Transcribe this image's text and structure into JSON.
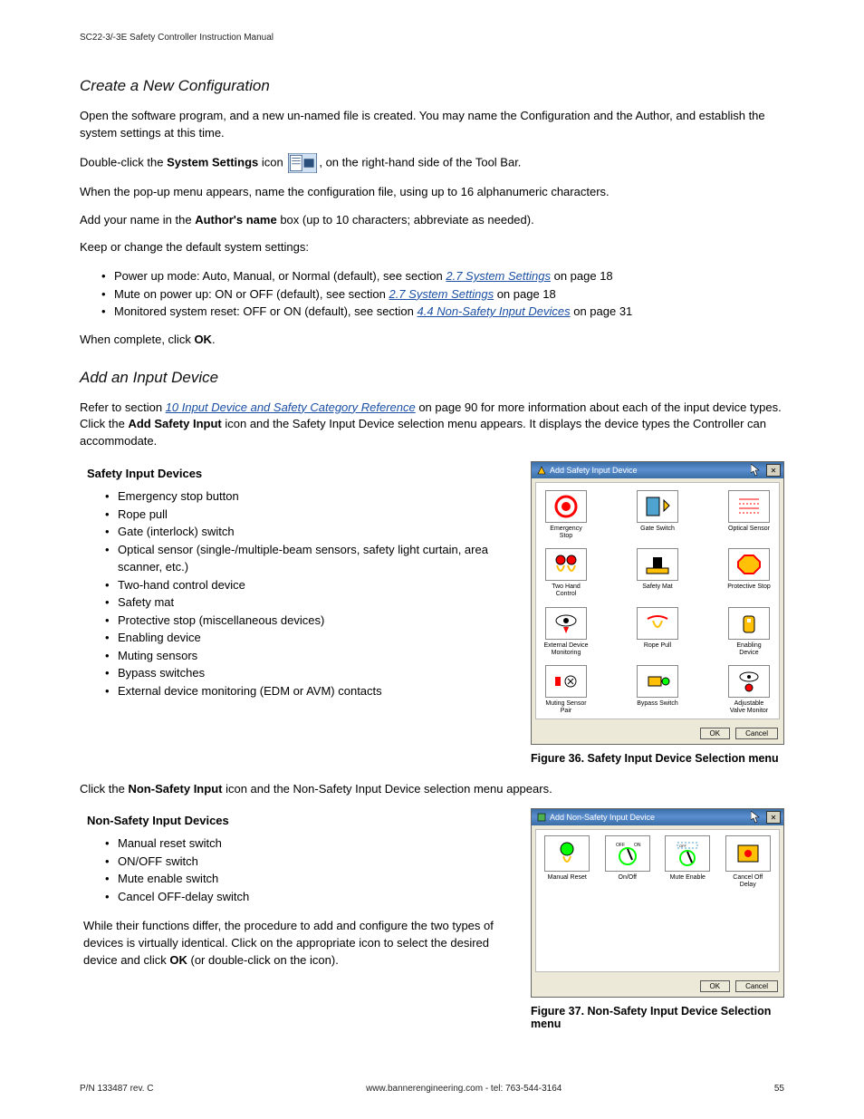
{
  "running_head": "SC22-3/-3E Safety Controller Instruction Manual",
  "sections": {
    "create_title": "Create a New Configuration",
    "create_p1": "Open the software program, and a new un-named file is created. You may name the Configuration and the Author, and establish the system settings at this time.",
    "create_p2_a": "Double-click the ",
    "create_p2_b": "System Settings",
    "create_p2_c": " icon ",
    "create_p2_d": ", on the right-hand side of the Tool Bar.",
    "create_p3": "When the pop-up menu appears, name the configuration file, using up to 16 alphanumeric characters.",
    "create_p4a": "Add your name in the ",
    "create_p4b": "Author's name",
    "create_p4c": " box (up to 10 characters; abbreviate as needed).",
    "create_p5": "Keep or change the default system settings:",
    "settings_list": [
      {
        "pre": "Power up mode: Auto, Manual, or Normal (default), see section ",
        "link": "2.7 System Settings",
        "post": " on page 18"
      },
      {
        "pre": "Mute on power up: ON or OFF (default), see section ",
        "link": "2.7 System Settings",
        "post": " on page 18"
      },
      {
        "pre": "Monitored system reset: OFF or ON (default), see section ",
        "link": "4.4 Non-Safety Input Devices",
        "post": " on page 31"
      }
    ],
    "create_done_a": "When complete, click ",
    "create_done_b": "OK",
    "create_done_c": ".",
    "add_title": "Add an Input Device",
    "add_p1_a": "Refer to section ",
    "add_p1_link": "10 Input Device and Safety Category Reference",
    "add_p1_b": " on page 90 for more information about each of the input device types. Click the ",
    "add_p1_bold": "Add Safety Input",
    "add_p1_c": " icon and the Safety Input Device selection menu appears. It displays the device types the Controller can accommodate.",
    "safety_heading": "Safety Input Devices",
    "safety_list": [
      "Emergency stop button",
      "Rope pull",
      "Gate (interlock) switch",
      "Optical sensor (single-/multiple-beam sensors, safety light curtain, area scanner, etc.)",
      "Two-hand control device",
      "Safety mat",
      "Protective stop (miscellaneous devices)",
      "Enabling device",
      "Muting sensors",
      "Bypass switches",
      "External device monitoring (EDM or AVM) contacts"
    ],
    "fig36_caption": "Figure 36. Safety Input Device Selection menu",
    "nonsafety_intro_a": "Click the ",
    "nonsafety_intro_b": "Non-Safety Input",
    "nonsafety_intro_c": " icon and the Non-Safety Input Device selection menu appears.",
    "nonsafety_heading": "Non-Safety Input Devices",
    "nonsafety_list": [
      "Manual reset switch",
      "ON/OFF switch",
      "Mute enable switch",
      "Cancel OFF-delay switch"
    ],
    "nonsafety_para_a": "While their functions differ, the procedure to add and configure the two types of devices is virtually identical. Click on the appropriate icon to select the desired device and click ",
    "nonsafety_para_bold": "OK",
    "nonsafety_para_b": " (or double-click on the icon).",
    "fig37_caption": "Figure 37. Non-Safety Input Device Selection menu"
  },
  "dialog_safety": {
    "title": "Add Safety Input Device",
    "items": [
      "Emergency Stop",
      "Gate Switch",
      "Optical Sensor",
      "Two Hand Control",
      "Safety Mat",
      "Protective Stop",
      "External Device Monitoring",
      "Rope Pull",
      "Enabling Device",
      "Muting Sensor Pair",
      "Bypass Switch",
      "Adjustable Valve Monitor"
    ],
    "ok": "OK",
    "cancel": "Cancel"
  },
  "dialog_nonsafety": {
    "title": "Add Non-Safety Input Device",
    "items": [
      "Manual Reset",
      "On/Off",
      "Mute Enable",
      "Cancel Off Delay"
    ],
    "ok": "OK",
    "cancel": "Cancel"
  },
  "footer": {
    "left": "P/N 133487 rev. C",
    "center": "www.bannerengineering.com - tel: 763-544-3164",
    "right": "55"
  }
}
